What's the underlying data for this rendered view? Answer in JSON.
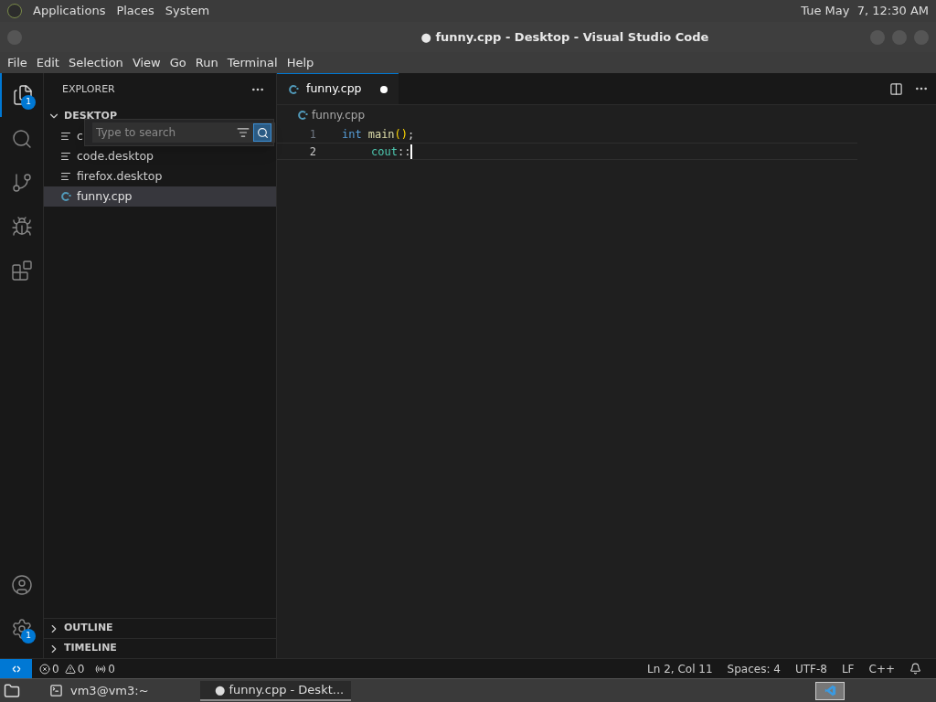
{
  "top_panel": {
    "menus": [
      "Applications",
      "Places",
      "System"
    ],
    "clock": "Tue May  7, 12:30 AM"
  },
  "window": {
    "title": "● funny.cpp - Desktop - Visual Studio Code"
  },
  "menu_bar": [
    "File",
    "Edit",
    "Selection",
    "View",
    "Go",
    "Run",
    "Terminal",
    "Help"
  ],
  "activity_bar": {
    "top": [
      {
        "kind": "files",
        "selected": true,
        "badge": "1"
      },
      {
        "kind": "search",
        "selected": false
      },
      {
        "kind": "source-control",
        "selected": false
      },
      {
        "kind": "run",
        "selected": false
      },
      {
        "kind": "extensions",
        "selected": false
      }
    ],
    "bottom": [
      {
        "kind": "account"
      },
      {
        "kind": "settings",
        "badge": "1"
      }
    ]
  },
  "sidebar": {
    "title": "EXPLORER",
    "folder": {
      "name": "DESKTOP",
      "expanded": true,
      "files": [
        {
          "name": "c",
          "kind": "text",
          "selected": false
        },
        {
          "name": "code.desktop",
          "kind": "text",
          "selected": false
        },
        {
          "name": "firefox.desktop",
          "kind": "text",
          "selected": false
        },
        {
          "name": "funny.cpp",
          "kind": "cpp",
          "selected": true
        }
      ]
    },
    "find_widget": {
      "placeholder": "Type to search",
      "fuzzy_match": true
    },
    "sections": [
      {
        "label": "OUTLINE",
        "expanded": false
      },
      {
        "label": "TIMELINE",
        "expanded": false
      }
    ]
  },
  "editor": {
    "tabs": [
      {
        "label": "funny.cpp",
        "dirty": true,
        "selected": true
      }
    ],
    "breadcrumb": "funny.cpp",
    "lines": [
      {
        "number": "1",
        "current": false,
        "indent": false,
        "tokens": [
          {
            "kind": "keyword",
            "text": "int"
          },
          {
            "kind": "function",
            "text": "main"
          },
          {
            "kind": "bracket",
            "text": "()"
          },
          {
            "kind": "plain",
            "text": ";"
          }
        ]
      },
      {
        "number": "2",
        "current": true,
        "indent": true,
        "tokens": [
          {
            "kind": "type",
            "text": "cout"
          },
          {
            "kind": "plain",
            "text": "::"
          }
        ]
      }
    ]
  },
  "status_bar": {
    "errors": "0",
    "warnings": "0",
    "ports": "0",
    "right": [
      "Ln 2, Col 11",
      "Spaces: 4",
      "UTF-8",
      "LF",
      "C++"
    ]
  },
  "taskbar": [
    {
      "kind": "terminal",
      "label": "vm3@vm3:~",
      "selected": false
    },
    {
      "kind": "vscode",
      "label": "● funny.cpp - Deskt...",
      "selected": true
    }
  ]
}
